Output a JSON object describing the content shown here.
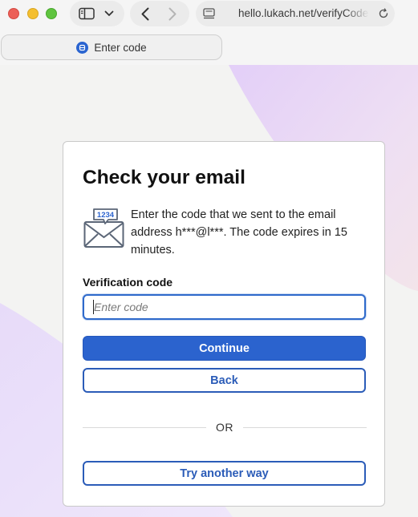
{
  "browser": {
    "url": "hello.lukach.net/verifyCode",
    "tab_title": "Enter code"
  },
  "card": {
    "title": "Check your email",
    "description": "Enter the code that we sent to the email address h***@l***. The code expires in 15 minutes.",
    "envelope_badge": "1234",
    "field_label": "Verification code",
    "input_placeholder": "Enter code",
    "input_value": "",
    "continue_label": "Continue",
    "back_label": "Back",
    "divider_text": "OR",
    "alt_label": "Try another way"
  },
  "colors": {
    "accent": "#2b63ce",
    "accent_dark": "#2b5cb8",
    "blob_purple": "#e6d3f7",
    "page_bg": "#f3f3f2"
  }
}
